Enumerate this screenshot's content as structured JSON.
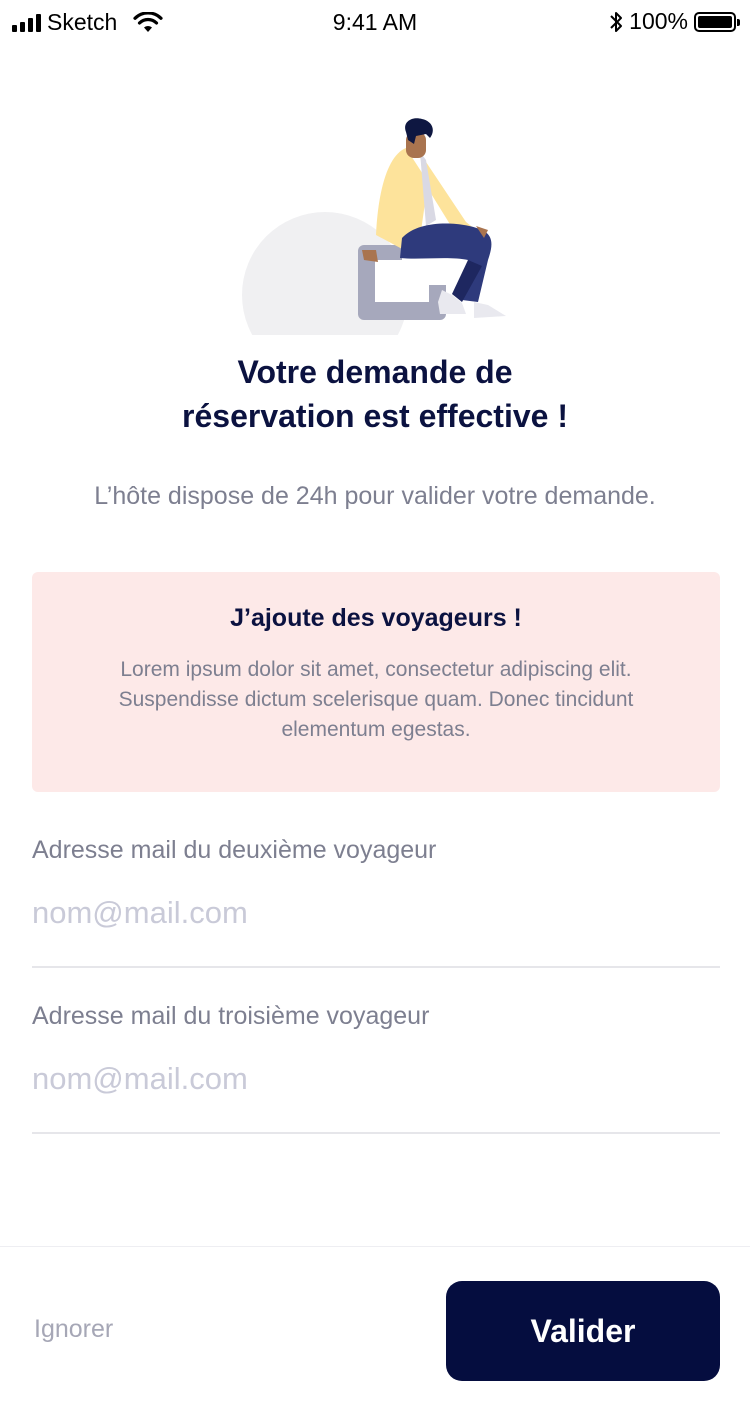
{
  "status_bar": {
    "carrier": "Sketch",
    "time": "9:41 AM",
    "battery_percent": "100%",
    "icons": [
      "signal-icon",
      "wifi-icon",
      "bluetooth-icon",
      "battery-icon"
    ]
  },
  "illustration": {
    "name": "person-sitting-illustration"
  },
  "confirmation": {
    "title_line1": "Votre demande de",
    "title_line2": "réservation est effective !",
    "subtitle": "L’hôte dispose de 24h pour valider votre  demande."
  },
  "travelers_card": {
    "title": "J’ajoute des voyageurs !",
    "body": "Lorem ipsum dolor sit amet, consectetur adipiscing elit. Suspendisse dictum scelerisque quam. Donec tincidunt elementum egestas."
  },
  "fields": [
    {
      "label": "Adresse mail du deuxième voyageur",
      "placeholder": "nom@mail.com",
      "value": ""
    },
    {
      "label": "Adresse mail du troisième voyageur",
      "placeholder": "nom@mail.com",
      "value": ""
    }
  ],
  "footer": {
    "ignore_label": "Ignorer",
    "validate_label": "Valider"
  },
  "colors": {
    "primary": "#050d3f",
    "title_text": "#0b1240",
    "muted_text": "#7d7f90",
    "card_background": "#fde9e8",
    "placeholder": "#c9cad8"
  }
}
